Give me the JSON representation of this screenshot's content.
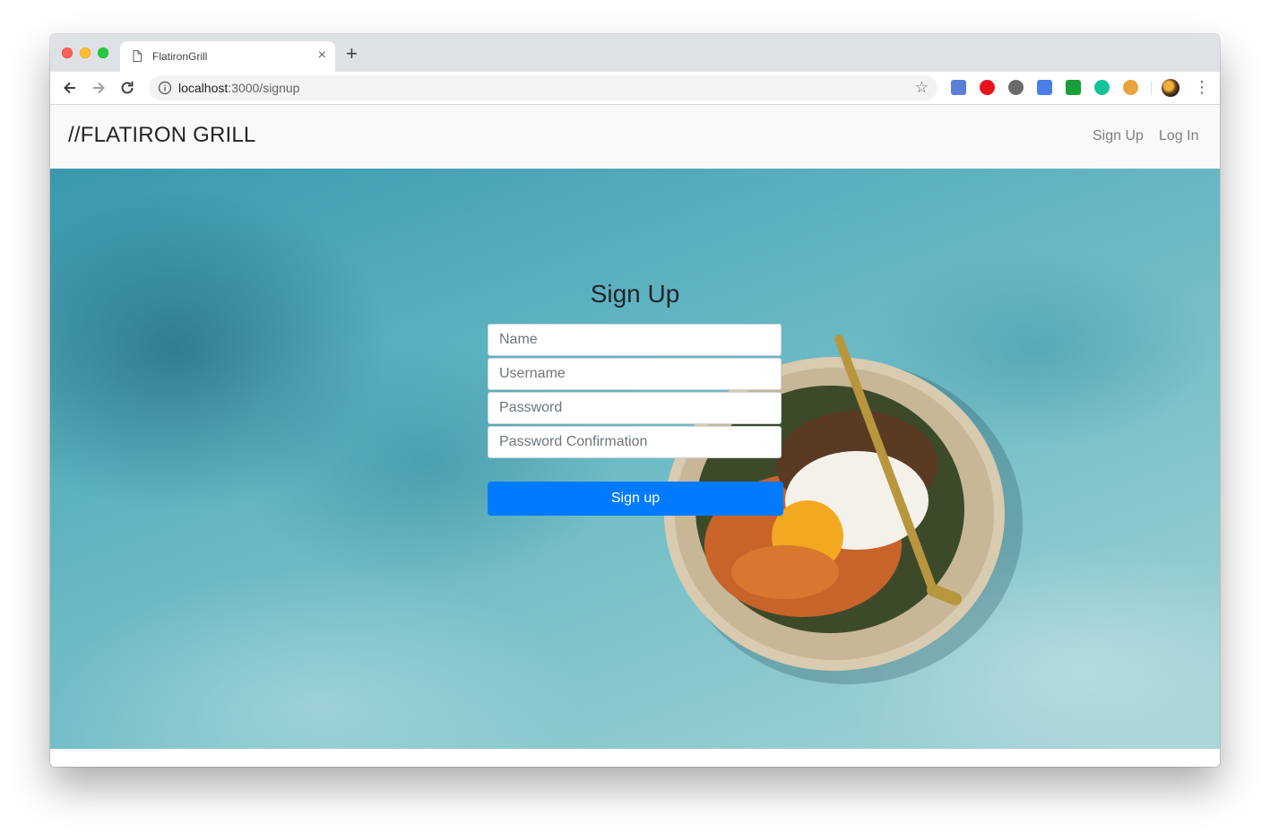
{
  "browser": {
    "tab": {
      "title": "FlatironGrill",
      "close_glyph": "×"
    },
    "new_tab_glyph": "+",
    "address": {
      "host": "localhost",
      "path": ":3000/signup"
    },
    "star_glyph": "☆",
    "menu_glyph": "⋮",
    "extensions": [
      "camera-extension-icon",
      "adblock-extension-icon",
      "film-extension-icon",
      "translate-extension-icon",
      "checkmark-extension-icon",
      "grammarly-extension-icon",
      "cookie-extension-icon"
    ]
  },
  "navbar": {
    "brand": "//FLATIRON GRILL",
    "links": [
      "Sign Up",
      "Log In"
    ]
  },
  "form": {
    "title": "Sign Up",
    "fields": {
      "name": "Name",
      "username": "Username",
      "password": "Password",
      "password_confirmation": "Password Confirmation"
    },
    "submit_label": "Sign up"
  },
  "colors": {
    "primary_button": "#007bff",
    "navbar_bg": "#f8f9fa"
  }
}
